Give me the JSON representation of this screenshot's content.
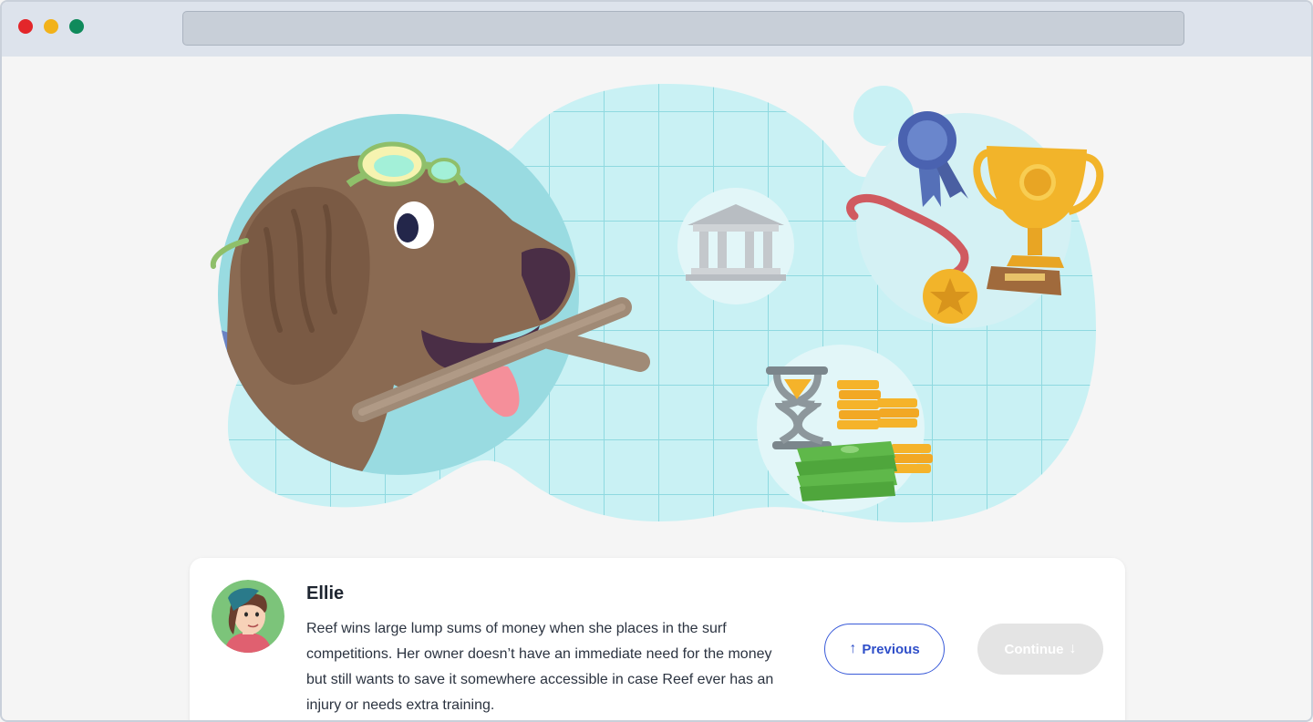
{
  "window": {
    "traffic_lights": [
      "close",
      "minimize",
      "maximize"
    ]
  },
  "dialogue": {
    "speaker": "Ellie",
    "text": "Reef wins large lump sums of money when she places in the surf competitions. Her owner doesn’t have an immediate need for the money but still wants to save it somewhere accessible in case Reef ever has an injury or needs extra training."
  },
  "buttons": {
    "previous": {
      "label": "Previous",
      "icon": "arrow-up-icon",
      "glyph": "↑"
    },
    "continue": {
      "label": "Continue",
      "icon": "arrow-down-icon",
      "glyph": "↓",
      "disabled": true
    }
  },
  "colors": {
    "accent": "#2f4fc9",
    "scene_bg": "#c9f1f4",
    "dog_circle": "#99dbe1"
  }
}
